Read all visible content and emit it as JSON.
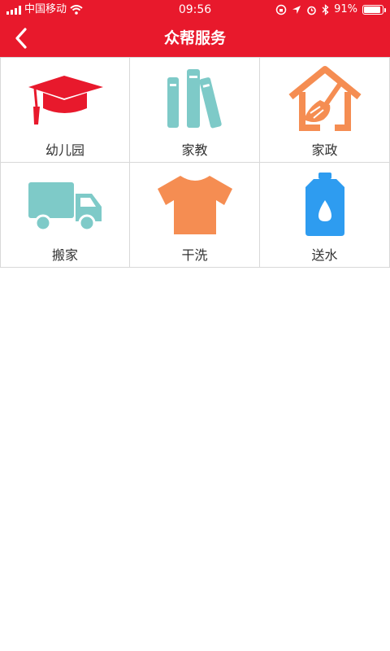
{
  "status_bar": {
    "carrier": "中国移动",
    "time": "09:56",
    "battery_percent": "91%",
    "battery_level": 0.91
  },
  "navbar": {
    "title": "众帮服务",
    "back_icon": "chevron-left-icon"
  },
  "colors": {
    "brand_red": "#e8192c",
    "teal": "#7ecac8",
    "orange": "#f58d52",
    "blue": "#2e9cf0"
  },
  "services": [
    {
      "label": "幼儿园",
      "icon": "graduation-cap-icon"
    },
    {
      "label": "家教",
      "icon": "books-icon"
    },
    {
      "label": "家政",
      "icon": "house-broom-icon"
    },
    {
      "label": "搬家",
      "icon": "truck-icon"
    },
    {
      "label": "干洗",
      "icon": "tshirt-icon"
    },
    {
      "label": "送水",
      "icon": "water-jug-icon"
    }
  ]
}
